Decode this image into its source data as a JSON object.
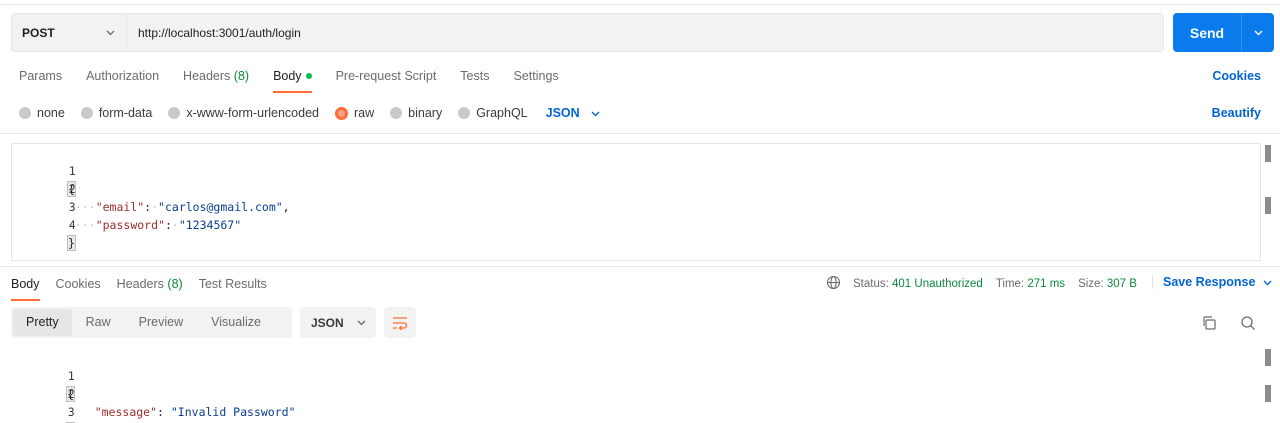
{
  "request": {
    "method": "POST",
    "url": "http://localhost:3001/auth/login",
    "send_label": "Send"
  },
  "req_tabs": {
    "params": "Params",
    "authorization": "Authorization",
    "headers": "Headers",
    "headers_count": "(8)",
    "body": "Body",
    "prerequest": "Pre-request Script",
    "tests": "Tests",
    "settings": "Settings",
    "cookies": "Cookies"
  },
  "body_types": {
    "none": "none",
    "form_data": "form-data",
    "urlencoded": "x-www-form-urlencoded",
    "raw": "raw",
    "binary": "binary",
    "graphql": "GraphQL",
    "format": "JSON",
    "beautify": "Beautify"
  },
  "request_body": {
    "line_numbers": [
      "1",
      "2",
      "3",
      "4"
    ],
    "open_brace": "{",
    "close_brace": "}",
    "email_key": "\"email\"",
    "email_value": "\"carlos@gmail.com\"",
    "password_key": "\"password\"",
    "password_value": "\"1234567\""
  },
  "res_tabs": {
    "body": "Body",
    "cookies": "Cookies",
    "headers": "Headers",
    "headers_count": "(8)",
    "test_results": "Test Results"
  },
  "status": {
    "status_label": "Status:",
    "status_value": "401 Unauthorized",
    "time_label": "Time:",
    "time_value": "271 ms",
    "size_label": "Size:",
    "size_value": "307 B",
    "save_response": "Save Response"
  },
  "view": {
    "pretty": "Pretty",
    "raw": "Raw",
    "preview": "Preview",
    "visualize": "Visualize",
    "format": "JSON"
  },
  "response_body": {
    "line_numbers": [
      "1",
      "2",
      "3"
    ],
    "open_brace": "{",
    "close_brace": "}",
    "message_key": "\"message\"",
    "message_value": "\"Invalid Password\""
  },
  "colors": {
    "accent": "#097bed",
    "active_tab": "#ff6c37",
    "status_ok": "#0a8a3a",
    "link": "#0265d2"
  },
  "icons": [
    "chevron-down-icon",
    "globe-icon",
    "wrap-lines-icon",
    "copy-icon",
    "search-icon"
  ]
}
